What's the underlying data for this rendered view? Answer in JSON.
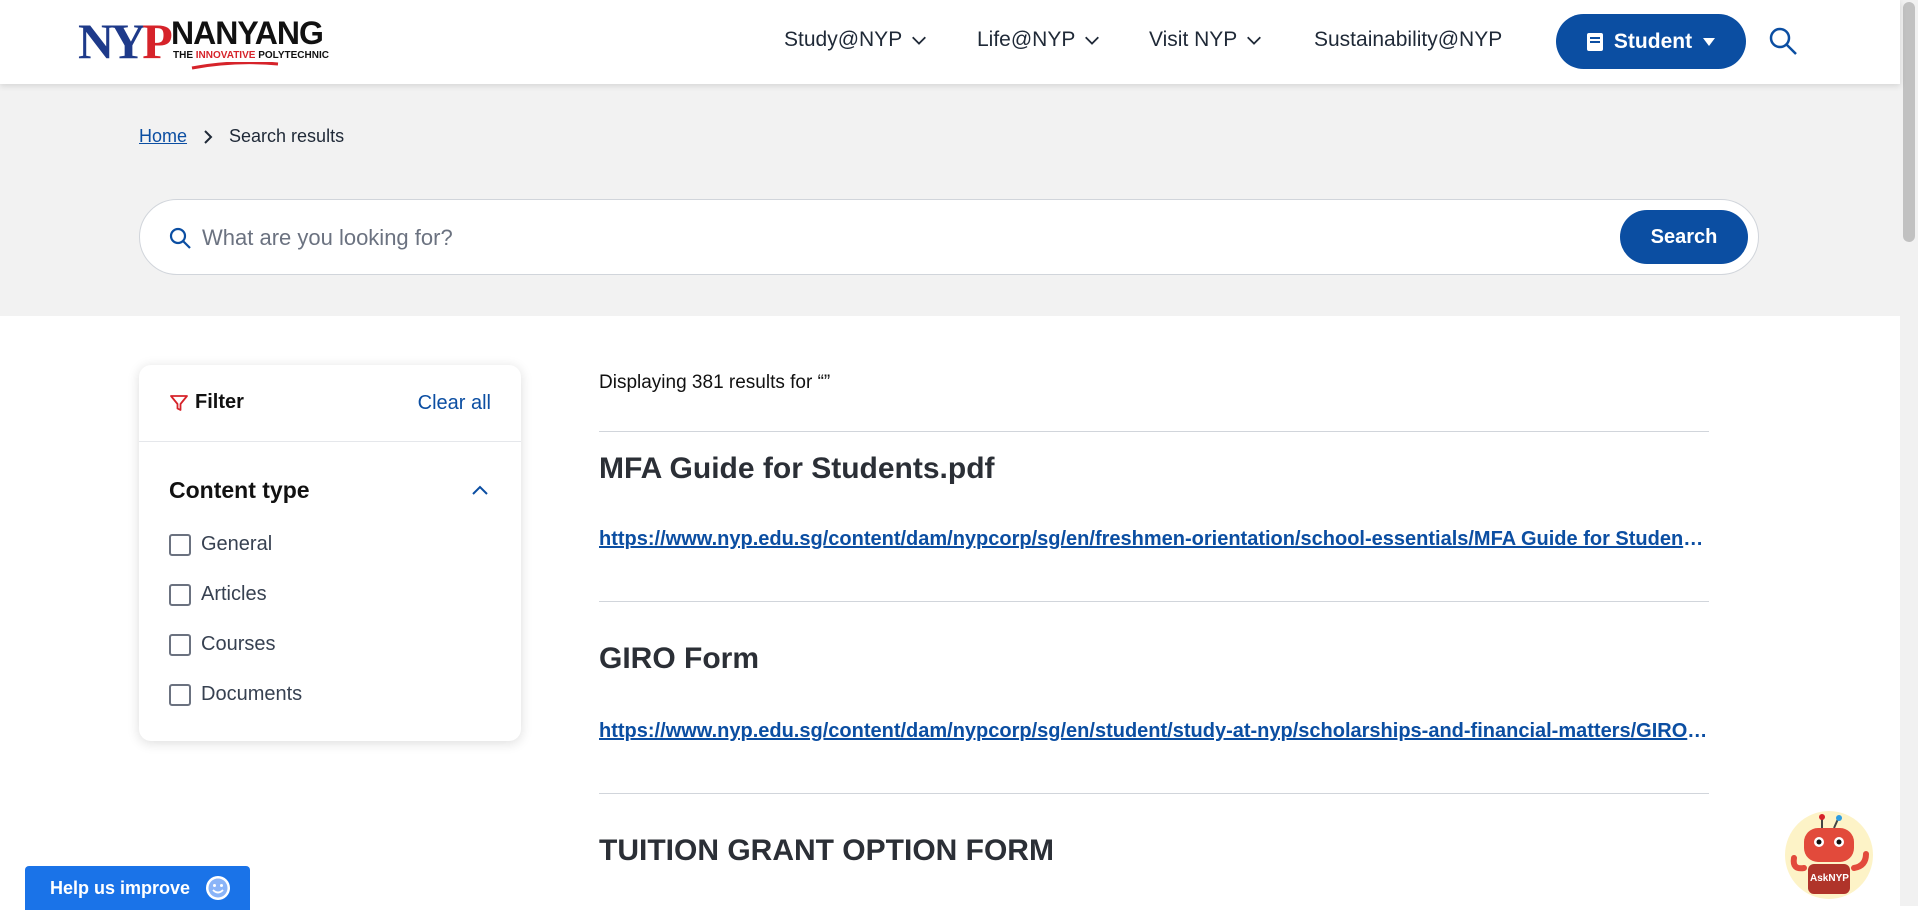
{
  "header": {
    "logo": {
      "mark": "NYP",
      "name": "NANYANG",
      "tagline_prefix": "THE ",
      "tagline_red": "INNOVATIVE",
      "tagline_suffix": " POLYTECHNIC"
    },
    "nav": [
      {
        "label": "Study@NYP",
        "has_dropdown": true
      },
      {
        "label": "Life@NYP",
        "has_dropdown": true
      },
      {
        "label": "Visit NYP",
        "has_dropdown": true
      },
      {
        "label": "Sustainability@NYP",
        "has_dropdown": false
      }
    ],
    "student_button": {
      "label": "Student",
      "icon": "book-icon"
    },
    "search_icon": "search-icon"
  },
  "breadcrumb": {
    "home": "Home",
    "current": "Search results"
  },
  "search": {
    "placeholder": "What are you looking for?",
    "value": "",
    "button_label": "Search"
  },
  "filter": {
    "title": "Filter",
    "clear_all": "Clear all",
    "content_type": {
      "label": "Content type",
      "options": [
        {
          "label": "General",
          "checked": false
        },
        {
          "label": "Articles",
          "checked": false
        },
        {
          "label": "Courses",
          "checked": false
        },
        {
          "label": "Documents",
          "checked": false
        }
      ]
    }
  },
  "results": {
    "summary": "Displaying 381 results for “”",
    "items": [
      {
        "title": "MFA Guide for Students.pdf",
        "url": "https://www.nyp.edu.sg/content/dam/nypcorp/sg/en/freshmen-orientation/school-essentials/MFA Guide for Students.pdf"
      },
      {
        "title": "GIRO Form",
        "url": "https://www.nyp.edu.sg/content/dam/nypcorp/sg/en/student/study-at-nyp/scholarships-and-financial-matters/GIRO Form.pdf"
      },
      {
        "title": "TUITION GRANT OPTION FORM",
        "url": ""
      }
    ]
  },
  "widgets": {
    "help_label": "Help us improve",
    "bot_label": "AskNYP"
  },
  "colors": {
    "brand_blue": "#0b4ea2",
    "brand_red": "#d6232a",
    "help_blue": "#1a73e8",
    "band_gray": "#f2f2f2"
  }
}
